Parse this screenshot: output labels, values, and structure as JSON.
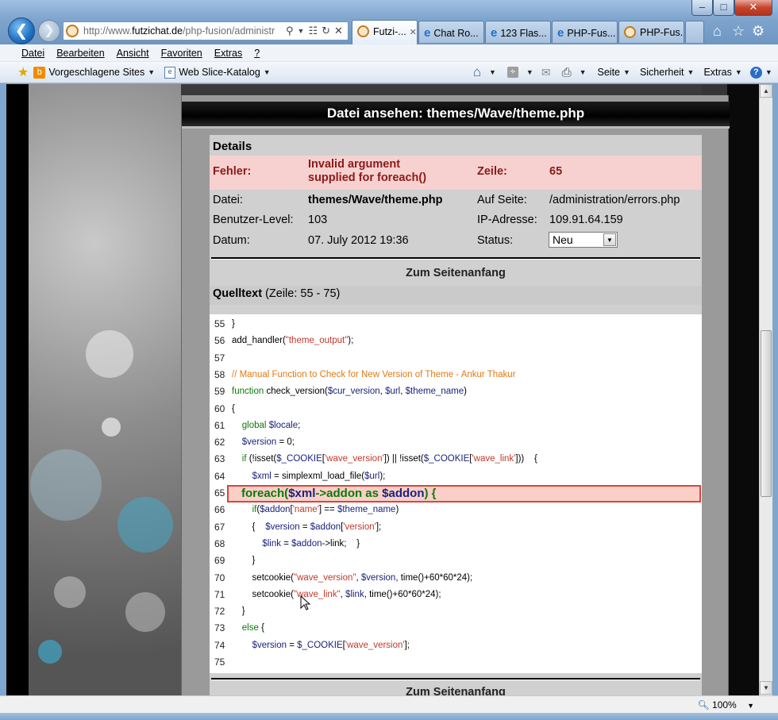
{
  "browser": {
    "address_url_host": "futzichat.de",
    "address_url_prefix": "http://www.",
    "address_url_suffix": "/php-fusion/administr",
    "tabs": [
      {
        "label": "Futzi-...",
        "active": true
      },
      {
        "label": "Chat Ro...",
        "active": false
      },
      {
        "label": "123 Flas...",
        "active": false
      },
      {
        "label": "PHP-Fus...",
        "active": false
      },
      {
        "label": "PHP-Fus...",
        "active": false
      }
    ],
    "menu": [
      "Datei",
      "Bearbeiten",
      "Ansicht",
      "Favoriten",
      "Extras",
      "?"
    ],
    "favorites": {
      "suggested": "Vorgeschlagene Sites",
      "web_slice": "Web Slice-Katalog"
    },
    "commands": {
      "page": "Seite",
      "security": "Sicherheit",
      "tools": "Extras"
    },
    "zoom": "100%"
  },
  "page": {
    "title": "Datei ansehen: themes/Wave/theme.php",
    "details_title": "Details",
    "error_label": "Fehler:",
    "error_value_1": "Invalid argument",
    "error_value_2": "supplied for foreach()",
    "line_label": "Zeile:",
    "line_value": "65",
    "file_label": "Datei:",
    "file_value": "themes/Wave/theme.php",
    "onpage_label": "Auf Seite:",
    "onpage_value": "/administration/errors.php",
    "userlevel_label": "Benutzer-Level:",
    "userlevel_value": "103",
    "ip_label": "IP-Adresse:",
    "ip_value": "109.91.64.159",
    "date_label": "Datum:",
    "date_value": "07. July 2012 19:36",
    "status_label": "Status:",
    "status_value": "Neu",
    "to_top_1": "Zum Seitenanfang",
    "source_title": "Quelltext",
    "source_range": "(Zeile: 55 - 75)",
    "to_top_2": "Zum Seitenanfang"
  },
  "code_lines": [
    {
      "n": "55",
      "html": "}"
    },
    {
      "n": "56",
      "html": "add_handler(<span class=\"c-str\">\"theme_output\"</span>);"
    },
    {
      "n": "57",
      "html": ""
    },
    {
      "n": "58",
      "html": "<span class=\"c-com\">// Manual Function to Check for New Version of Theme - Ankur Thakur</span>"
    },
    {
      "n": "59",
      "html": "<span class=\"c-kw\">function</span> check_version(<span class=\"c-var\">$cur_version</span>, <span class=\"c-var\">$url</span>, <span class=\"c-var\">$theme_name</span>)"
    },
    {
      "n": "60",
      "html": "{"
    },
    {
      "n": "61",
      "html": "    <span class=\"c-kw\">global</span> <span class=\"c-var\">$locale</span>;"
    },
    {
      "n": "62",
      "html": "    <span class=\"c-var\">$version</span> = 0;"
    },
    {
      "n": "63",
      "html": "    <span class=\"c-kw\">if</span> (!isset(<span class=\"c-var\">$_COOKIE</span>[<span class=\"c-str\">'wave_version'</span>]) || !isset(<span class=\"c-var\">$_COOKIE</span>[<span class=\"c-str\">'wave_link'</span>]))    {"
    },
    {
      "n": "64",
      "html": "        <span class=\"c-var\">$xml</span> = simplexml_load_file(<span class=\"c-var\">$url</span>);"
    },
    {
      "n": "65",
      "html": "foreach($xml->addon as $addon) {",
      "highlight": true
    },
    {
      "n": "66",
      "html": "        <span class=\"c-kw\">if</span>(<span class=\"c-var\">$addon</span>[<span class=\"c-str\">'name'</span>] == <span class=\"c-var\">$theme_name</span>)"
    },
    {
      "n": "67",
      "html": "        {    <span class=\"c-var\">$version</span> = <span class=\"c-var\">$addon</span>[<span class=\"c-str\">'version'</span>];"
    },
    {
      "n": "68",
      "html": "            <span class=\"c-var\">$link</span> = <span class=\"c-var\">$addon</span>-&gt;link;    }"
    },
    {
      "n": "69",
      "html": "        }"
    },
    {
      "n": "70",
      "html": "        setcookie(<span class=\"c-str\">\"wave_version\"</span>, <span class=\"c-var\">$version</span>, time()+60*60*24);"
    },
    {
      "n": "71",
      "html": "        setcookie(<span class=\"c-str\">\"wave_link\"</span>, <span class=\"c-var\">$link</span>, time()+60*60*24);"
    },
    {
      "n": "72",
      "html": "    }"
    },
    {
      "n": "73",
      "html": "    <span class=\"c-kw\">else</span> {"
    },
    {
      "n": "74",
      "html": "        <span class=\"c-var\">$version</span> = <span class=\"c-var\">$_COOKIE</span>[<span class=\"c-str\">'wave_version'</span>];"
    },
    {
      "n": "75",
      "html": ""
    }
  ]
}
